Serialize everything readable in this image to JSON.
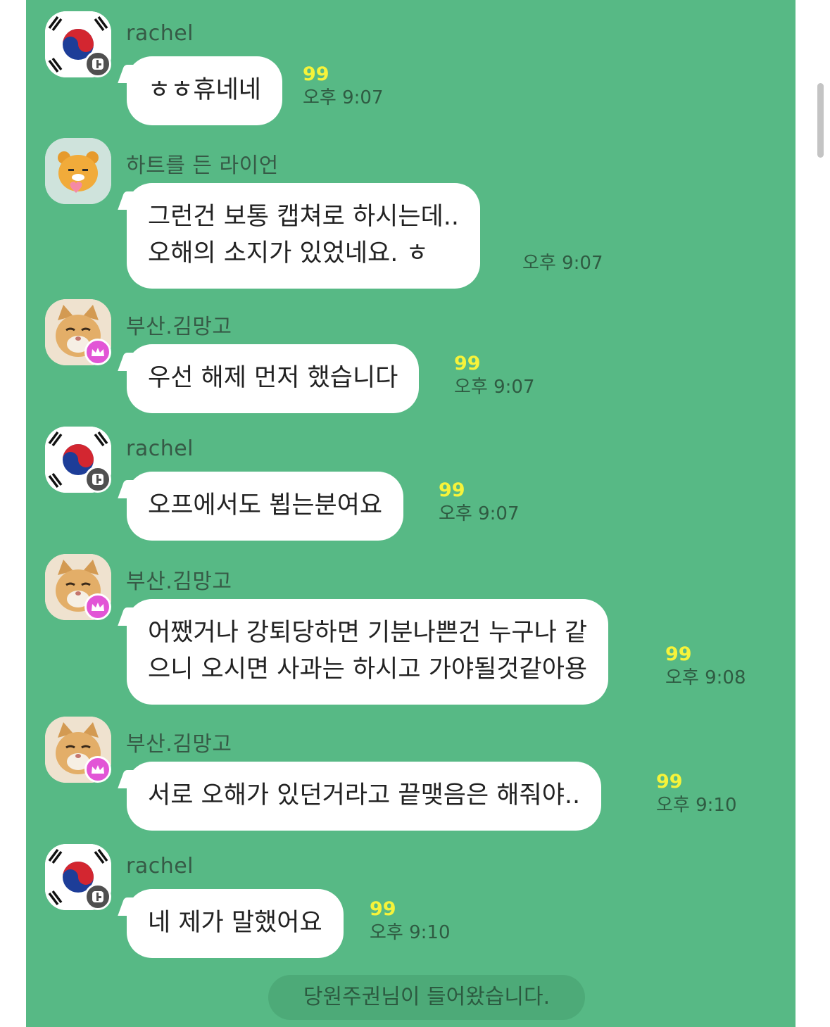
{
  "chat": {
    "messages": [
      {
        "nickname": "rachel",
        "lines": [
          "ㅎㅎ휴네네"
        ],
        "unread": "99",
        "time": "오후 9:07"
      },
      {
        "nickname": "하트를 든 라이언",
        "lines": [
          "그런건 보통 캡쳐로 하시는데..",
          "오해의 소지가 있었네요. ㅎ"
        ],
        "unread": "",
        "time": "오후 9:07"
      },
      {
        "nickname": "부산.김망고",
        "lines": [
          "우선 해제 먼저 했습니다"
        ],
        "unread": "99",
        "time": "오후 9:07"
      },
      {
        "nickname": "rachel",
        "lines": [
          "오프에서도 뵙는분여요"
        ],
        "unread": "99",
        "time": "오후 9:07"
      },
      {
        "nickname": "부산.김망고",
        "lines": [
          "어쨌거나 강퇴당하면 기분나쁜건 누구나 같",
          "으니 오시면 사과는 하시고 가야될것같아용"
        ],
        "unread": "99",
        "time": "오후 9:08"
      },
      {
        "nickname": "부산.김망고",
        "lines": [
          "서로 오해가 있던거라고 끝맺음은 해줘야.."
        ],
        "unread": "99",
        "time": "오후 9:10"
      },
      {
        "nickname": "rachel",
        "lines": [
          "네 제가 말했어요"
        ],
        "unread": "99",
        "time": "오후 9:10"
      }
    ],
    "notice": "당원주권님이 들어왔습니다."
  },
  "colors": {
    "background": "#57b985",
    "bubble": "#ffffff",
    "unread": "#f6f33a",
    "host_badge": "#e255d6"
  },
  "icons": {
    "rachel_avatar": "korean-flag-icon",
    "lion_avatar": "ryan-lion-holding-heart-icon",
    "mango_avatar": "orange-cat-icon",
    "rachel_badge": "open-profile-badge-icon",
    "mango_badge": "crown-icon"
  }
}
